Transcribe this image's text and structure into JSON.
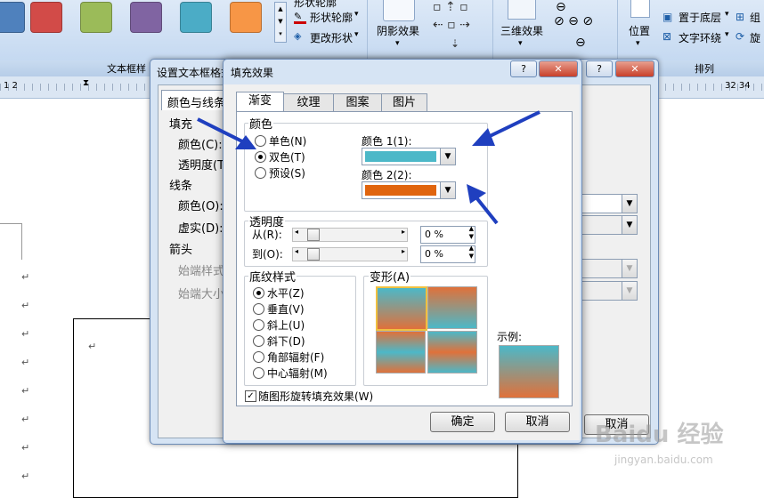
{
  "ribbon": {
    "swatch_colors": [
      "#d24b48",
      "#9bbb59",
      "#8064a2",
      "#4bacc6",
      "#f79646"
    ],
    "shape_outline": "形状轮廓",
    "shape_effect_partial": "形状轮廓",
    "change_shape": "更改形状",
    "shadow_effect": "阴影效果",
    "three_d": "三维效果",
    "position": "位置",
    "send_back": "置于底层",
    "text_wrap": "文字环绕",
    "rotate_partial": "旋",
    "group_partial": "组",
    "group_textbox": "文本框样",
    "group_arrange": "排列"
  },
  "ruler": {
    "left": "1 2",
    "right": "32 34"
  },
  "back_dialog": {
    "title": "设置文本框格式",
    "tab": "颜色与线条",
    "fill": "填充",
    "color": "颜色(C):",
    "transparency": "透明度(T)",
    "line": "线条",
    "line_color": "颜色(O):",
    "dash": "虚实(D):",
    "arrows": "箭头",
    "begin_style": "始端样式",
    "begin_size": "始端大小",
    "cancel": "取消"
  },
  "dialog": {
    "title": "填充效果",
    "help": "?",
    "close": "✕",
    "tabs": [
      "渐变",
      "纹理",
      "图案",
      "图片"
    ],
    "color_group": "颜色",
    "single": "单色(N)",
    "two": "双色(T)",
    "preset": "预设(S)",
    "color1_label": "颜色 1(1):",
    "color2_label": "颜色 2(2):",
    "color1": "#4cb8c8",
    "color2": "#e0650f",
    "transparency_group": "透明度",
    "from": "从(R):",
    "to": "到(O):",
    "from_val": "0 %",
    "to_val": "0 %",
    "shading_group": "底纹样式",
    "horizontal": "水平(Z)",
    "vertical": "垂直(V)",
    "diag_up": "斜上(U)",
    "diag_down": "斜下(D)",
    "corner": "角部辐射(F)",
    "center": "中心辐射(M)",
    "variants": "变形(A)",
    "sample": "示例:",
    "rotate_check": "随图形旋转填充效果(W)",
    "ok": "确定",
    "cancel": "取消"
  },
  "watermark": {
    "brand": "Baidu 经验",
    "url": "jingyan.baidu.com"
  }
}
